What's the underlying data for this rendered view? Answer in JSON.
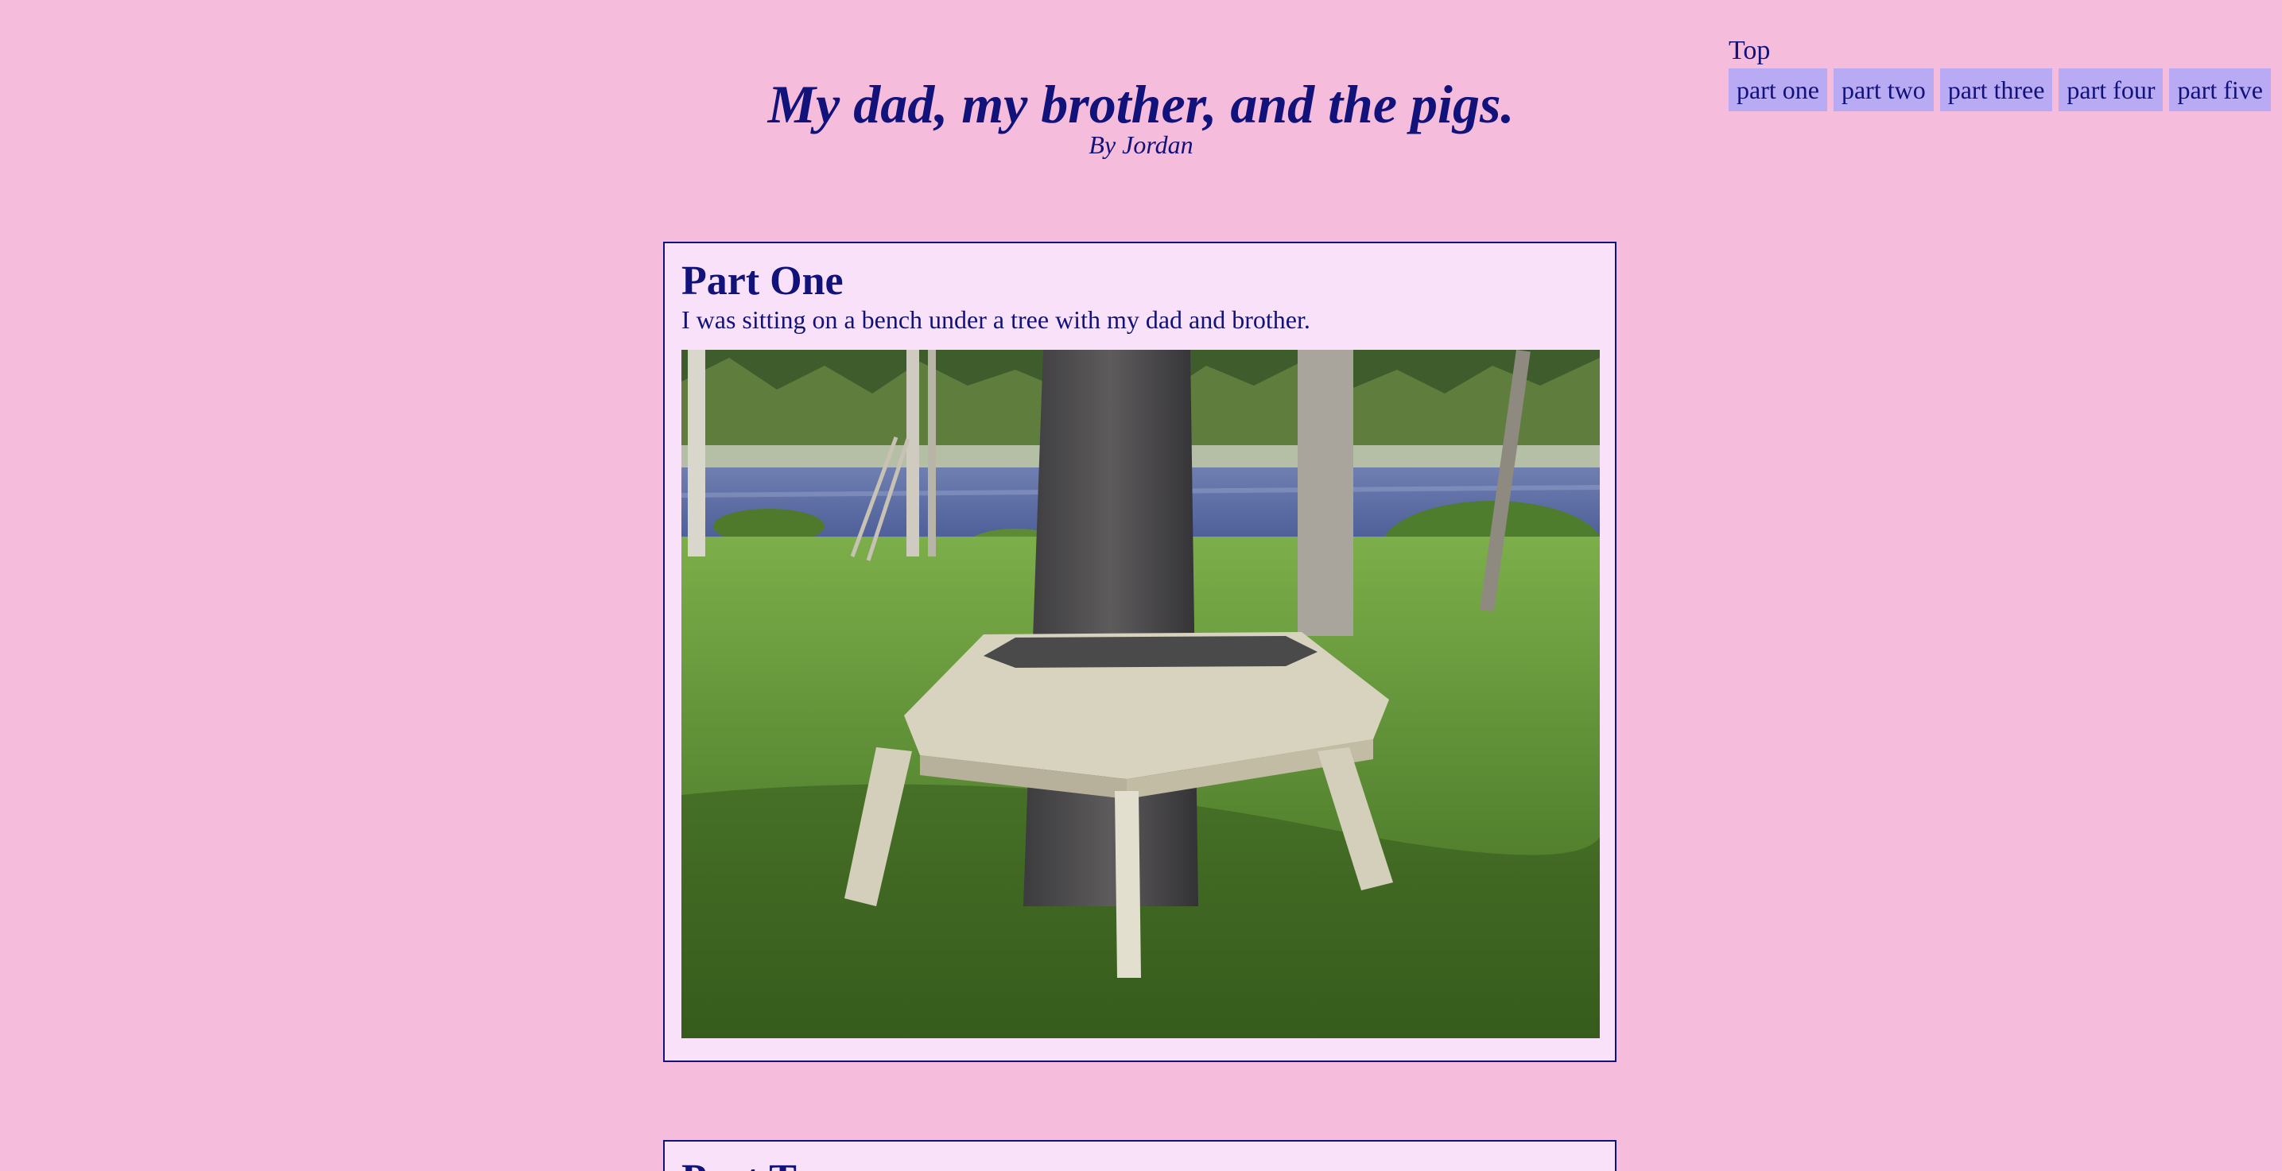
{
  "nav": {
    "top_label": "Top",
    "items": [
      {
        "label": "part one"
      },
      {
        "label": "part two"
      },
      {
        "label": "part three"
      },
      {
        "label": "part four"
      },
      {
        "label": "part five"
      }
    ]
  },
  "header": {
    "title": "My dad, my brother, and the pigs.",
    "byline": "By Jordan"
  },
  "parts": [
    {
      "heading": "Part One",
      "text": "I was sitting on a bench under a tree with my dad and brother."
    },
    {
      "heading": "Part Two"
    }
  ],
  "colors": {
    "page_background": "#f5bcdc",
    "panel_background": "#f9e1f9",
    "text": "#11127a",
    "nav_button": "#b9aaf4"
  }
}
